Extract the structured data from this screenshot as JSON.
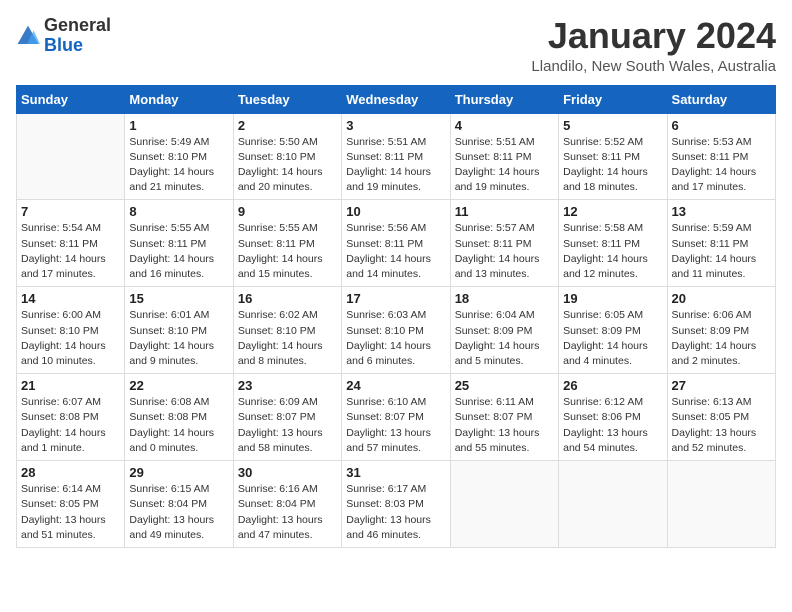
{
  "header": {
    "logo_general": "General",
    "logo_blue": "Blue",
    "title": "January 2024",
    "subtitle": "Llandilo, New South Wales, Australia"
  },
  "days_of_week": [
    "Sunday",
    "Monday",
    "Tuesday",
    "Wednesday",
    "Thursday",
    "Friday",
    "Saturday"
  ],
  "weeks": [
    [
      {
        "day": "",
        "info": ""
      },
      {
        "day": "1",
        "info": "Sunrise: 5:49 AM\nSunset: 8:10 PM\nDaylight: 14 hours\nand 21 minutes."
      },
      {
        "day": "2",
        "info": "Sunrise: 5:50 AM\nSunset: 8:10 PM\nDaylight: 14 hours\nand 20 minutes."
      },
      {
        "day": "3",
        "info": "Sunrise: 5:51 AM\nSunset: 8:11 PM\nDaylight: 14 hours\nand 19 minutes."
      },
      {
        "day": "4",
        "info": "Sunrise: 5:51 AM\nSunset: 8:11 PM\nDaylight: 14 hours\nand 19 minutes."
      },
      {
        "day": "5",
        "info": "Sunrise: 5:52 AM\nSunset: 8:11 PM\nDaylight: 14 hours\nand 18 minutes."
      },
      {
        "day": "6",
        "info": "Sunrise: 5:53 AM\nSunset: 8:11 PM\nDaylight: 14 hours\nand 17 minutes."
      }
    ],
    [
      {
        "day": "7",
        "info": "Sunrise: 5:54 AM\nSunset: 8:11 PM\nDaylight: 14 hours\nand 17 minutes."
      },
      {
        "day": "8",
        "info": "Sunrise: 5:55 AM\nSunset: 8:11 PM\nDaylight: 14 hours\nand 16 minutes."
      },
      {
        "day": "9",
        "info": "Sunrise: 5:55 AM\nSunset: 8:11 PM\nDaylight: 14 hours\nand 15 minutes."
      },
      {
        "day": "10",
        "info": "Sunrise: 5:56 AM\nSunset: 8:11 PM\nDaylight: 14 hours\nand 14 minutes."
      },
      {
        "day": "11",
        "info": "Sunrise: 5:57 AM\nSunset: 8:11 PM\nDaylight: 14 hours\nand 13 minutes."
      },
      {
        "day": "12",
        "info": "Sunrise: 5:58 AM\nSunset: 8:11 PM\nDaylight: 14 hours\nand 12 minutes."
      },
      {
        "day": "13",
        "info": "Sunrise: 5:59 AM\nSunset: 8:11 PM\nDaylight: 14 hours\nand 11 minutes."
      }
    ],
    [
      {
        "day": "14",
        "info": "Sunrise: 6:00 AM\nSunset: 8:10 PM\nDaylight: 14 hours\nand 10 minutes."
      },
      {
        "day": "15",
        "info": "Sunrise: 6:01 AM\nSunset: 8:10 PM\nDaylight: 14 hours\nand 9 minutes."
      },
      {
        "day": "16",
        "info": "Sunrise: 6:02 AM\nSunset: 8:10 PM\nDaylight: 14 hours\nand 8 minutes."
      },
      {
        "day": "17",
        "info": "Sunrise: 6:03 AM\nSunset: 8:10 PM\nDaylight: 14 hours\nand 6 minutes."
      },
      {
        "day": "18",
        "info": "Sunrise: 6:04 AM\nSunset: 8:09 PM\nDaylight: 14 hours\nand 5 minutes."
      },
      {
        "day": "19",
        "info": "Sunrise: 6:05 AM\nSunset: 8:09 PM\nDaylight: 14 hours\nand 4 minutes."
      },
      {
        "day": "20",
        "info": "Sunrise: 6:06 AM\nSunset: 8:09 PM\nDaylight: 14 hours\nand 2 minutes."
      }
    ],
    [
      {
        "day": "21",
        "info": "Sunrise: 6:07 AM\nSunset: 8:08 PM\nDaylight: 14 hours\nand 1 minute."
      },
      {
        "day": "22",
        "info": "Sunrise: 6:08 AM\nSunset: 8:08 PM\nDaylight: 14 hours\nand 0 minutes."
      },
      {
        "day": "23",
        "info": "Sunrise: 6:09 AM\nSunset: 8:07 PM\nDaylight: 13 hours\nand 58 minutes."
      },
      {
        "day": "24",
        "info": "Sunrise: 6:10 AM\nSunset: 8:07 PM\nDaylight: 13 hours\nand 57 minutes."
      },
      {
        "day": "25",
        "info": "Sunrise: 6:11 AM\nSunset: 8:07 PM\nDaylight: 13 hours\nand 55 minutes."
      },
      {
        "day": "26",
        "info": "Sunrise: 6:12 AM\nSunset: 8:06 PM\nDaylight: 13 hours\nand 54 minutes."
      },
      {
        "day": "27",
        "info": "Sunrise: 6:13 AM\nSunset: 8:05 PM\nDaylight: 13 hours\nand 52 minutes."
      }
    ],
    [
      {
        "day": "28",
        "info": "Sunrise: 6:14 AM\nSunset: 8:05 PM\nDaylight: 13 hours\nand 51 minutes."
      },
      {
        "day": "29",
        "info": "Sunrise: 6:15 AM\nSunset: 8:04 PM\nDaylight: 13 hours\nand 49 minutes."
      },
      {
        "day": "30",
        "info": "Sunrise: 6:16 AM\nSunset: 8:04 PM\nDaylight: 13 hours\nand 47 minutes."
      },
      {
        "day": "31",
        "info": "Sunrise: 6:17 AM\nSunset: 8:03 PM\nDaylight: 13 hours\nand 46 minutes."
      },
      {
        "day": "",
        "info": ""
      },
      {
        "day": "",
        "info": ""
      },
      {
        "day": "",
        "info": ""
      }
    ]
  ]
}
